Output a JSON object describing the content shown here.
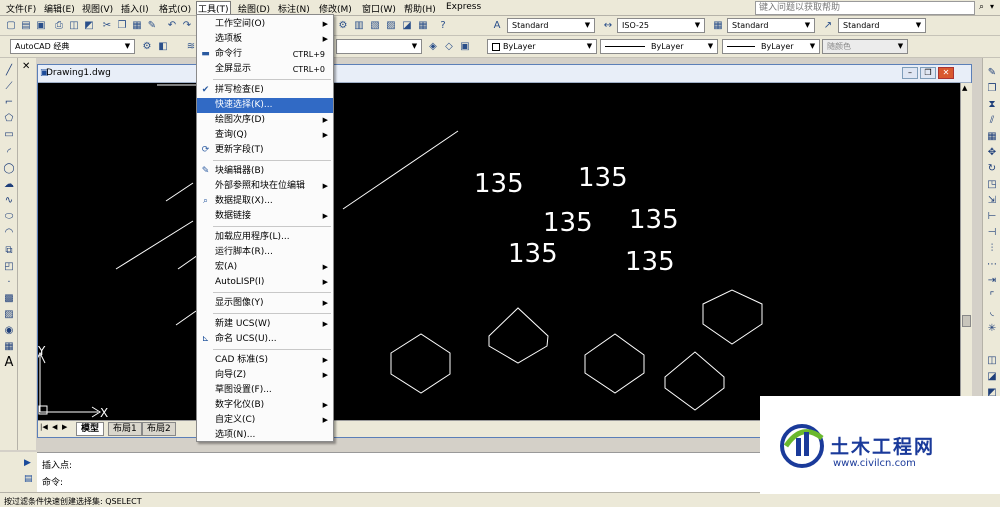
{
  "menubar": {
    "items": [
      "文件(F)",
      "编辑(E)",
      "视图(V)",
      "插入(I)",
      "格式(O)",
      "工具(T)",
      "绘图(D)",
      "标注(N)",
      "修改(M)",
      "窗口(W)",
      "帮助(H)",
      "Express"
    ],
    "help_placeholder": "键入问题以获取帮助"
  },
  "toolbar": {
    "workspace": "AutoCAD 经典",
    "text_style": "Standard",
    "dim_style": "ISO-25",
    "table_style": "Standard",
    "multileader_style": "Standard",
    "layer_color": "ByLayer",
    "linetype": "ByLayer",
    "lineweight": "ByLayer",
    "plot_style": "随颜色"
  },
  "document": {
    "title": "Drawing1.dwg",
    "tabs": [
      "模型",
      "布局1",
      "布局2"
    ],
    "active_tab": "模型"
  },
  "canvas": {
    "numbers": [
      "135",
      "135",
      "135",
      "135",
      "135",
      "135"
    ],
    "ucs_x": "X",
    "ucs_y": "Y",
    "hexagon_count": 5
  },
  "tools_menu": [
    {
      "label": "工作空间(O)",
      "shortcut": "",
      "submenu": true,
      "icon": ""
    },
    {
      "label": "选项板",
      "shortcut": "",
      "submenu": true,
      "icon": ""
    },
    {
      "label": "命令行",
      "shortcut": "CTRL+9",
      "submenu": false,
      "icon": "command-line-icon"
    },
    {
      "label": "全屏显示",
      "shortcut": "CTRL+0",
      "submenu": false,
      "icon": ""
    },
    {
      "label": "拼写检查(E)",
      "shortcut": "",
      "submenu": false,
      "icon": "spell-check-icon"
    },
    {
      "label": "快速选择(K)...",
      "shortcut": "",
      "submenu": false,
      "icon": "",
      "highlighted": true
    },
    {
      "label": "绘图次序(D)",
      "shortcut": "",
      "submenu": true,
      "icon": ""
    },
    {
      "label": "查询(Q)",
      "shortcut": "",
      "submenu": true,
      "icon": ""
    },
    {
      "label": "更新字段(T)",
      "shortcut": "",
      "submenu": false,
      "icon": "update-field-icon"
    },
    {
      "label": "块编辑器(B)",
      "shortcut": "",
      "submenu": false,
      "icon": "block-editor-icon"
    },
    {
      "label": "外部参照和块在位编辑",
      "shortcut": "",
      "submenu": true,
      "icon": ""
    },
    {
      "label": "数据提取(X)...",
      "shortcut": "",
      "submenu": false,
      "icon": "data-extraction-icon"
    },
    {
      "label": "数据链接",
      "shortcut": "",
      "submenu": true,
      "icon": ""
    },
    {
      "label": "加载应用程序(L)...",
      "shortcut": "",
      "submenu": false,
      "icon": ""
    },
    {
      "label": "运行脚本(R)...",
      "shortcut": "",
      "submenu": false,
      "icon": ""
    },
    {
      "label": "宏(A)",
      "shortcut": "",
      "submenu": true,
      "icon": ""
    },
    {
      "label": "AutoLISP(I)",
      "shortcut": "",
      "submenu": true,
      "icon": ""
    },
    {
      "label": "显示图像(Y)",
      "shortcut": "",
      "submenu": true,
      "icon": ""
    },
    {
      "label": "新建 UCS(W)",
      "shortcut": "",
      "submenu": true,
      "icon": ""
    },
    {
      "label": "命名 UCS(U)...",
      "shortcut": "",
      "submenu": false,
      "icon": "named-ucs-icon"
    },
    {
      "label": "CAD 标准(S)",
      "shortcut": "",
      "submenu": true,
      "icon": ""
    },
    {
      "label": "向导(Z)",
      "shortcut": "",
      "submenu": true,
      "icon": ""
    },
    {
      "label": "草图设置(F)...",
      "shortcut": "",
      "submenu": false,
      "icon": ""
    },
    {
      "label": "数字化仪(B)",
      "shortcut": "",
      "submenu": true,
      "icon": ""
    },
    {
      "label": "自定义(C)",
      "shortcut": "",
      "submenu": true,
      "icon": ""
    },
    {
      "label": "选项(N)...",
      "shortcut": "",
      "submenu": false,
      "icon": ""
    }
  ],
  "command": {
    "line1": "插入点:",
    "line2": "命令:"
  },
  "status": {
    "text": "按过滤条件快速创建选择集:  QSELECT"
  },
  "watermark": {
    "title": "土木工程网",
    "url": "www.civilcn.com"
  },
  "colors": {
    "highlight": "#316ac5",
    "canvas_bg": "#000000",
    "stroke": "#ffffff"
  }
}
